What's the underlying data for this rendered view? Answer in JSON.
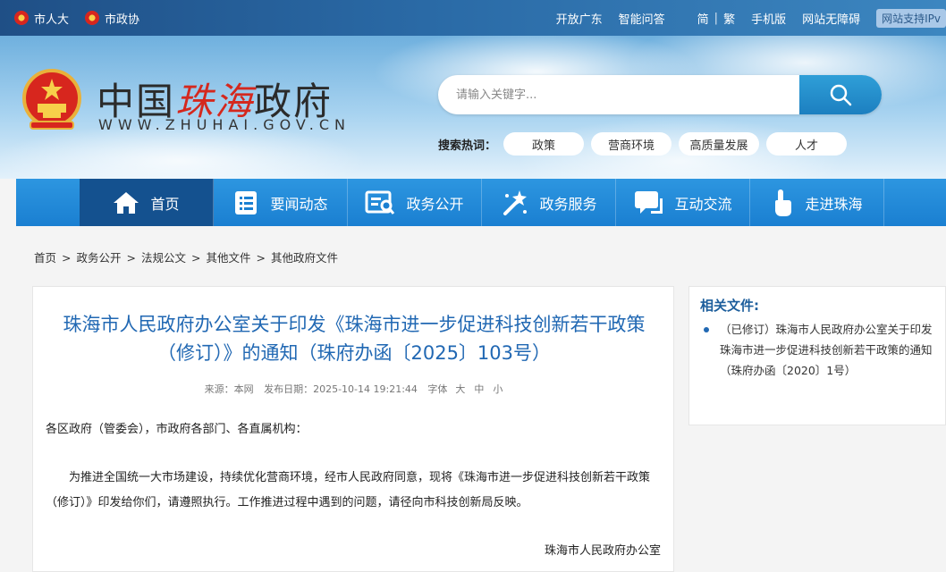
{
  "topbar": {
    "links_left": [
      "市人大",
      "市政协"
    ],
    "links_right": [
      "开放广东",
      "智能问答",
      "简",
      "繁",
      "手机版",
      "网站无障碍"
    ],
    "ipv6_label": "网站支持IPv"
  },
  "header": {
    "title_prefix": "中国",
    "title_accent": "珠海",
    "title_suffix": "政府",
    "domain": "WWW.ZHUHAI.GOV.CN"
  },
  "search": {
    "placeholder": "请输入关键字...",
    "hot_label": "搜索热词：",
    "hot_tags": [
      "政策",
      "营商环境",
      "高质量发展",
      "人才"
    ]
  },
  "nav": {
    "items": [
      "首页",
      "要闻动态",
      "政务公开",
      "政务服务",
      "互动交流",
      "走进珠海"
    ]
  },
  "breadcrumb": [
    "首页",
    "政务公开",
    "法规公文",
    "其他文件",
    "其他政府文件"
  ],
  "article": {
    "title_line1": "珠海市人民政府办公室关于印发《珠海市进一步促进科技创新若干政策",
    "title_line2": "（修订）》的通知（珠府办函〔2025〕103号）",
    "source": "来源：本网",
    "date": "发布日期：2025-10-14 19:21:44",
    "font_label": "字体",
    "font_sizes": [
      "大",
      "中",
      "小"
    ],
    "addressee": "各区政府（管委会），市政府各部门、各直属机构：",
    "body": "为推进全国统一大市场建设，持续优化营商环境，经市人民政府同意，现将《珠海市进一步促进科技创新若干政策（修订）》印发给你们，请遵照执行。工作推进过程中遇到的问题，请径向市科技创新局反映。",
    "signature": "珠海市人民政府办公室"
  },
  "related": {
    "heading": "相关文件:",
    "items": [
      "（已修订）珠海市人民政府办公室关于印发珠海市进一步促进科技创新若干政策的通知（珠府办函〔2020〕1号）"
    ]
  },
  "colors": {
    "nav_blue": "#1a7fd1",
    "nav_active": "#14518f",
    "title_blue": "#2168b3",
    "accent_red": "#d4281e"
  }
}
